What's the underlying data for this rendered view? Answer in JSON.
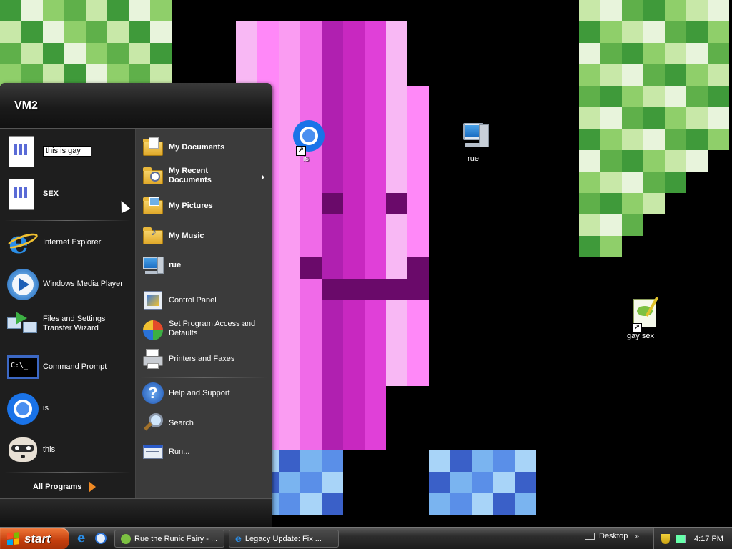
{
  "desktop": {
    "icons": [
      {
        "label": "is",
        "icon": "chrome-icon"
      },
      {
        "label": "rue",
        "icon": "computer-icon"
      },
      {
        "label": "gay sex",
        "icon": "notepad-plus-icon"
      }
    ]
  },
  "start_menu": {
    "username": "VM2",
    "pinned": [
      {
        "label": "this is gay",
        "icon": "document-icon",
        "renaming": true
      },
      {
        "label": "SEX",
        "icon": "document-icon"
      }
    ],
    "recent": [
      {
        "label": "Internet Explorer",
        "icon": "internet-explorer-icon"
      },
      {
        "label": "Windows Media Player",
        "icon": "media-player-icon"
      },
      {
        "label": "Files and Settings Transfer Wizard",
        "icon": "transfer-wizard-icon"
      },
      {
        "label": "Command Prompt",
        "icon": "command-prompt-icon"
      },
      {
        "label": "is",
        "icon": "chrome-icon"
      },
      {
        "label": "this",
        "icon": "raccoon-icon"
      }
    ],
    "all_programs": "All Programs",
    "places": [
      {
        "label": "My Documents",
        "bold": true
      },
      {
        "label": "My Recent Documents",
        "bold": true,
        "submenu": true
      },
      {
        "label": "My Pictures",
        "bold": true
      },
      {
        "label": "My Music",
        "bold": true
      },
      {
        "label": "rue",
        "bold": true
      }
    ],
    "system": [
      {
        "label": "Control Panel"
      },
      {
        "label": "Set Program Access and Defaults"
      },
      {
        "label": "Printers and Faxes"
      }
    ],
    "help": [
      {
        "label": "Help and Support"
      },
      {
        "label": "Search"
      },
      {
        "label": "Run..."
      }
    ]
  },
  "taskbar": {
    "start_label": "start",
    "tasks": [
      {
        "label": "Rue the Runic Fairy - ..."
      },
      {
        "label": "Legacy Update: Fix ..."
      }
    ],
    "desktop_toolbar": "Desktop",
    "clock": "4:17 PM"
  },
  "colors": {
    "start_button": "#c23d0c",
    "menu_dark": "#1e1e1e",
    "menu_right": "#3b3b3b",
    "accent_orange": "#f08a24"
  }
}
